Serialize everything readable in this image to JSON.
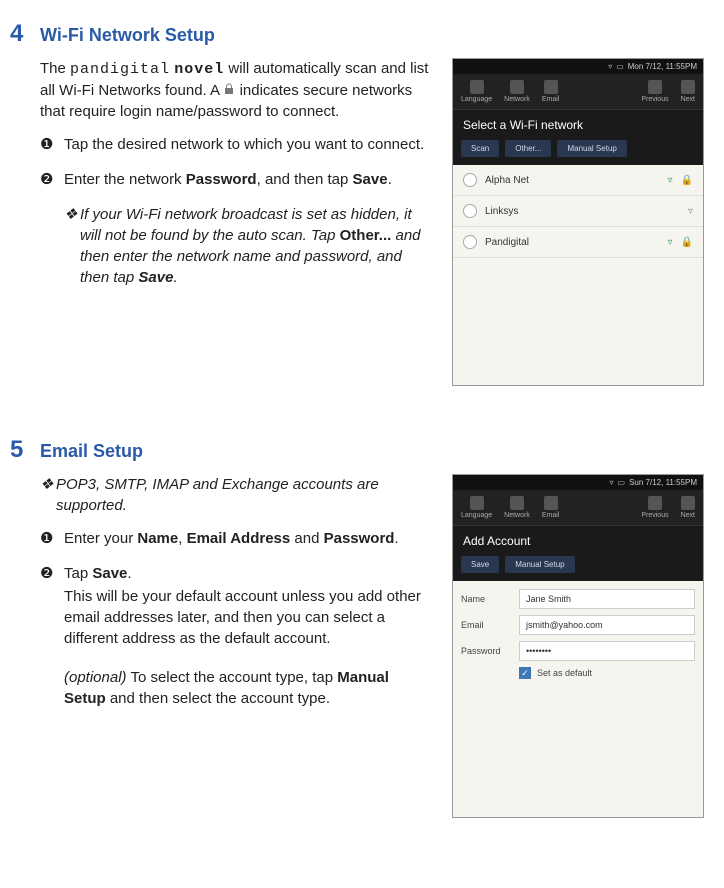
{
  "section4": {
    "number": "4",
    "title": "Wi-Fi Network Setup",
    "intro_prefix": "The ",
    "intro_brand1": "pandigital",
    "intro_brand2": "novel",
    "intro_mid": " will automatically scan and list all Wi-Fi Networks found. A ",
    "intro_suffix": " indicates secure networks that require login name/password to connect.",
    "step1": "Tap the desired network to which you want to connect.",
    "step2_a": "Enter the network ",
    "step2_b": "Password",
    "step2_c": ", and then tap ",
    "step2_d": "Save",
    "step2_e": ".",
    "note_a": "If your Wi-Fi network broadcast is set as hidden, it will not be found by the auto scan. Tap ",
    "note_b": "Other...",
    "note_c": " and then enter the network name and password, and then tap ",
    "note_d": "Save",
    "note_e": "."
  },
  "section5": {
    "number": "5",
    "title": "Email Setup",
    "note_top": "POP3, SMTP, IMAP and Exchange accounts are supported.",
    "step1_a": "Enter your ",
    "step1_b": "Name",
    "step1_c": ", ",
    "step1_d": "Email Address",
    "step1_e": " and ",
    "step1_f": "Password",
    "step1_g": ".",
    "step2_a": "Tap ",
    "step2_b": "Save",
    "step2_c": ".",
    "step2_body": "This will be your default account unless you add other email addresses later, and then you can select a different address as the default account.",
    "step2_opt_a": "(optional)",
    "step2_opt_b": " To select the account type, tap ",
    "step2_opt_c": "Manual Setup",
    "step2_opt_d": " and then select the account type."
  },
  "ss_wifi": {
    "time": "Mon 7/12, 11:55PM",
    "nav_language": "Language",
    "nav_network": "Network",
    "nav_email": "Email",
    "nav_previous": "Previous",
    "nav_next": "Next",
    "header": "Select a Wi-Fi network",
    "tab_scan": "Scan",
    "tab_other": "Other...",
    "tab_manual": "Manual Setup",
    "networks": [
      {
        "name": "Alpha Net",
        "secure": true
      },
      {
        "name": "Linksys",
        "secure": false
      },
      {
        "name": "Pandigital",
        "secure": true
      }
    ]
  },
  "ss_email": {
    "time": "Sun 7/12, 11:55PM",
    "nav_language": "Language",
    "nav_network": "Network",
    "nav_email": "Email",
    "nav_previous": "Previous",
    "nav_next": "Next",
    "header": "Add Account",
    "tab_save": "Save",
    "tab_manual": "Manual Setup",
    "label_name": "Name",
    "label_email": "Email",
    "label_password": "Password",
    "value_name": "Jane Smith",
    "value_email": "jsmith@yahoo.com",
    "value_password": "••••••••",
    "set_default": "Set as default"
  }
}
